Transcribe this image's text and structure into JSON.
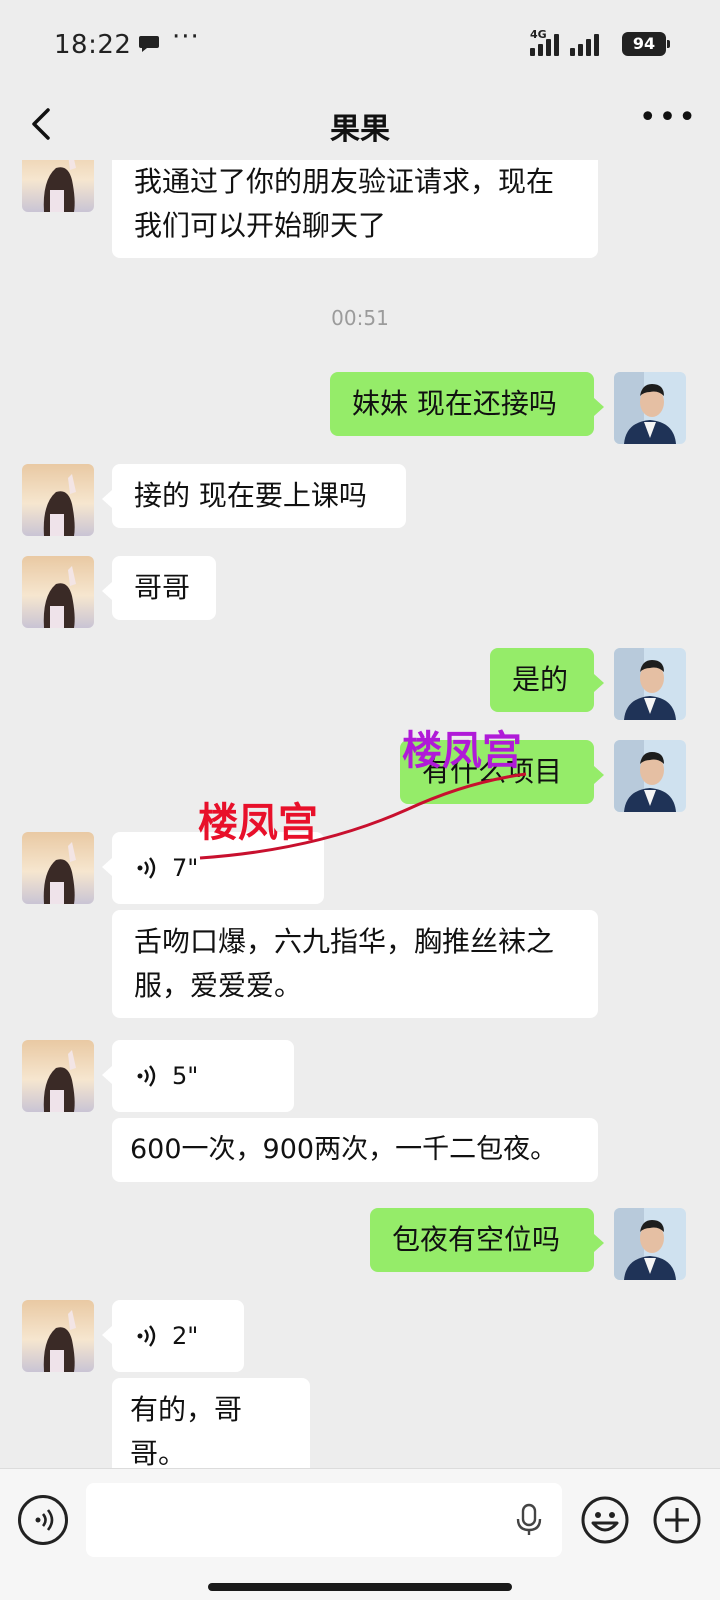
{
  "status_bar": {
    "time": "18:22",
    "network": "4G",
    "battery": "94"
  },
  "header": {
    "title": "果果"
  },
  "chat": {
    "timestamp": "00:51",
    "messages": [
      {
        "from": "contact",
        "text": "我通过了你的朋友验证请求，现在我们可以开始聊天了"
      },
      {
        "from": "me",
        "text": "妹妹 现在还接吗"
      },
      {
        "from": "contact",
        "text": "接的 现在要上课吗"
      },
      {
        "from": "contact",
        "text": "哥哥"
      },
      {
        "from": "me",
        "text": "是的"
      },
      {
        "from": "me",
        "text": "有什么项目"
      },
      {
        "from": "contact",
        "type": "voice",
        "duration": "7\""
      },
      {
        "from": "contact",
        "text": "舌吻口爆，六九指华，胸推丝袜之服，爱爱爱。"
      },
      {
        "from": "contact",
        "type": "voice",
        "duration": "5\""
      },
      {
        "from": "contact",
        "text": "600一次，900两次，一千二包夜。"
      },
      {
        "from": "me",
        "text": "包夜有空位吗"
      },
      {
        "from": "contact",
        "type": "voice",
        "duration": "2\""
      },
      {
        "from": "contact",
        "text": "有的，哥哥。"
      }
    ]
  },
  "watermarks": [
    "楼凤宫",
    "楼凤宫"
  ],
  "colors": {
    "my_bubble": "#95ec69",
    "their_bubble": "#ffffff",
    "background": "#ededed"
  },
  "input_bar": {
    "voice_icon": "voice-mode-icon",
    "mic_icon": "microphone-icon",
    "emoji_icon": "emoji-icon",
    "plus_icon": "plus-icon"
  }
}
